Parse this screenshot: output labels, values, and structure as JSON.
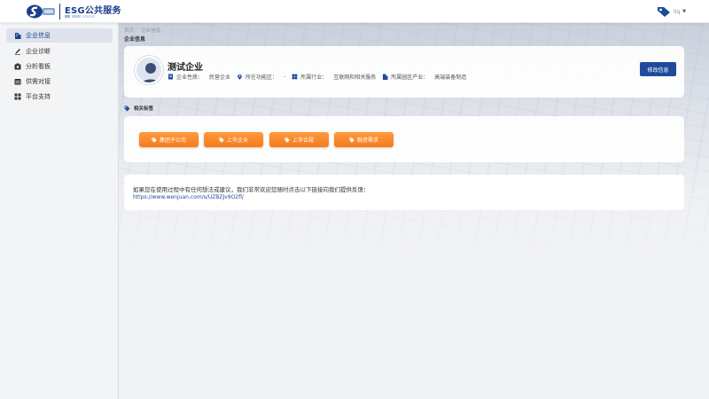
{
  "header": {
    "app_title": "ESG公共服务",
    "user_name": "liq"
  },
  "sidebar": {
    "items": [
      {
        "label": "企业信息",
        "icon": "building-icon",
        "active": true
      },
      {
        "label": "企业诊断",
        "icon": "diagnosis-pen-icon",
        "active": false
      },
      {
        "label": "分析看板",
        "icon": "dashboard-icon",
        "active": false
      },
      {
        "label": "供需对接",
        "icon": "supply-demand-icon",
        "active": false
      },
      {
        "label": "平台支持",
        "icon": "grid-apps-icon",
        "active": false
      }
    ]
  },
  "breadcrumb": [
    "首页",
    "企业信息"
  ],
  "page_title": "企业信息",
  "profile": {
    "company_name": "测试企业",
    "fields": [
      {
        "label": "企业性质：",
        "value": "民营企业",
        "icon": "document-icon"
      },
      {
        "label": "所在功能区：",
        "value": "-",
        "icon": "location-pin-icon"
      },
      {
        "label": "所属行业：",
        "value": "互联网和相关服务",
        "icon": "industry-grid-icon"
      },
      {
        "label": "所属园区产业：",
        "value": "高端装备制造",
        "icon": "park-building-icon"
      }
    ],
    "edit_button": "修改信息"
  },
  "tags": {
    "header": "相关标签",
    "items": [
      "集团子公司",
      "上市企业",
      "上市合规",
      "融资需求"
    ]
  },
  "feedback": {
    "text": "如果您在使用过程中有任何想法或建议，我们非常欢迎您随时点击以下链接向我们提供反馈：",
    "link": "https://www.wenjuan.com/s/UZBZJv9O2fl/"
  },
  "colors": {
    "brand": "#1f4b9a",
    "tag_orange": "#f57c1f",
    "sidebar_bg": "#f3f4f6",
    "active_item_bg": "#dde2ec"
  }
}
